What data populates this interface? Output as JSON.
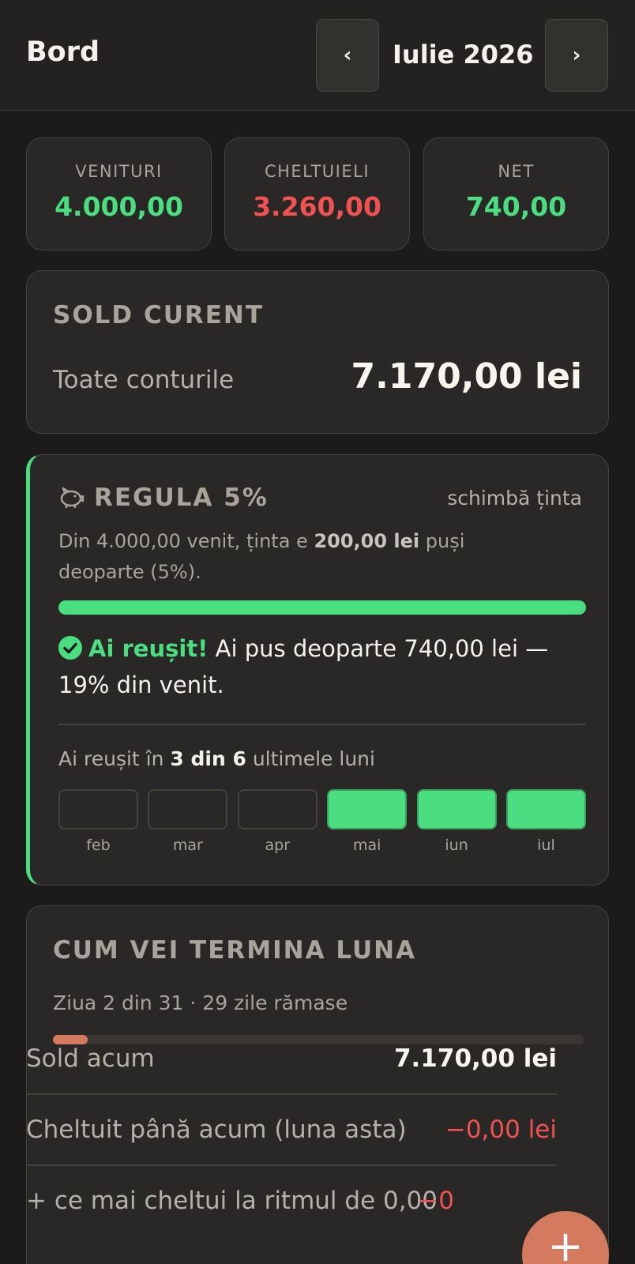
{
  "header": {
    "title": "Bord",
    "prev_label": "‹",
    "next_label": "›",
    "month": "Iulie 2026"
  },
  "stats": [
    {
      "label": "VENITURI",
      "value": "4.000,00",
      "color": "#4ade80"
    },
    {
      "label": "CHELTUIELI",
      "value": "3.260,00",
      "color": "#f05252"
    },
    {
      "label": "NET",
      "value": "740,00",
      "color": "#4ade80"
    }
  ],
  "balance": {
    "title": "SOLD CURENT",
    "label": "Toate conturile",
    "value": "7.170,00 lei"
  },
  "rule": {
    "icon": "piggy-bank-icon",
    "title": "REGULA 5%",
    "change_link": "schimbă ținta",
    "desc_prefix": "Din 4.000,00 venit, ținta e ",
    "desc_target": "200,00 lei",
    "desc_suffix": " puși deoparte (5%).",
    "progress_fraction": 1.0,
    "success_strong": "Ai reușit!",
    "success_text": " Ai pus deoparte 740,00 lei — 19% din venit.",
    "streak_prefix": "Ai reușit în ",
    "streak_count": "3 din 6",
    "streak_suffix": " ultimele luni",
    "months": [
      {
        "name": "feb",
        "done": false
      },
      {
        "name": "mar",
        "done": false
      },
      {
        "name": "apr",
        "done": false
      },
      {
        "name": "mai",
        "done": true
      },
      {
        "name": "iun",
        "done": true
      },
      {
        "name": "iul",
        "done": true
      }
    ]
  },
  "forecast": {
    "title": "CUM VEI TERMINA LUNA",
    "day_info": "Ziua 2 din 31 · 29 zile rămase",
    "day_progress": 0.065,
    "rows": [
      {
        "label": "Sold acum",
        "value": "7.170,00 lei"
      },
      {
        "label": "Cheltuit până acum (luna asta)",
        "value": "−0,00 lei"
      },
      {
        "label": "+ ce mai cheltui la ritmul de 0,00",
        "value": "−0"
      }
    ]
  },
  "fab": {
    "label": "+"
  },
  "colors": {
    "accent_green": "#4ade80",
    "accent_red": "#f05252",
    "accent_orange": "#d47a5e",
    "background": "#1c1b19",
    "card": "#2a2826"
  }
}
